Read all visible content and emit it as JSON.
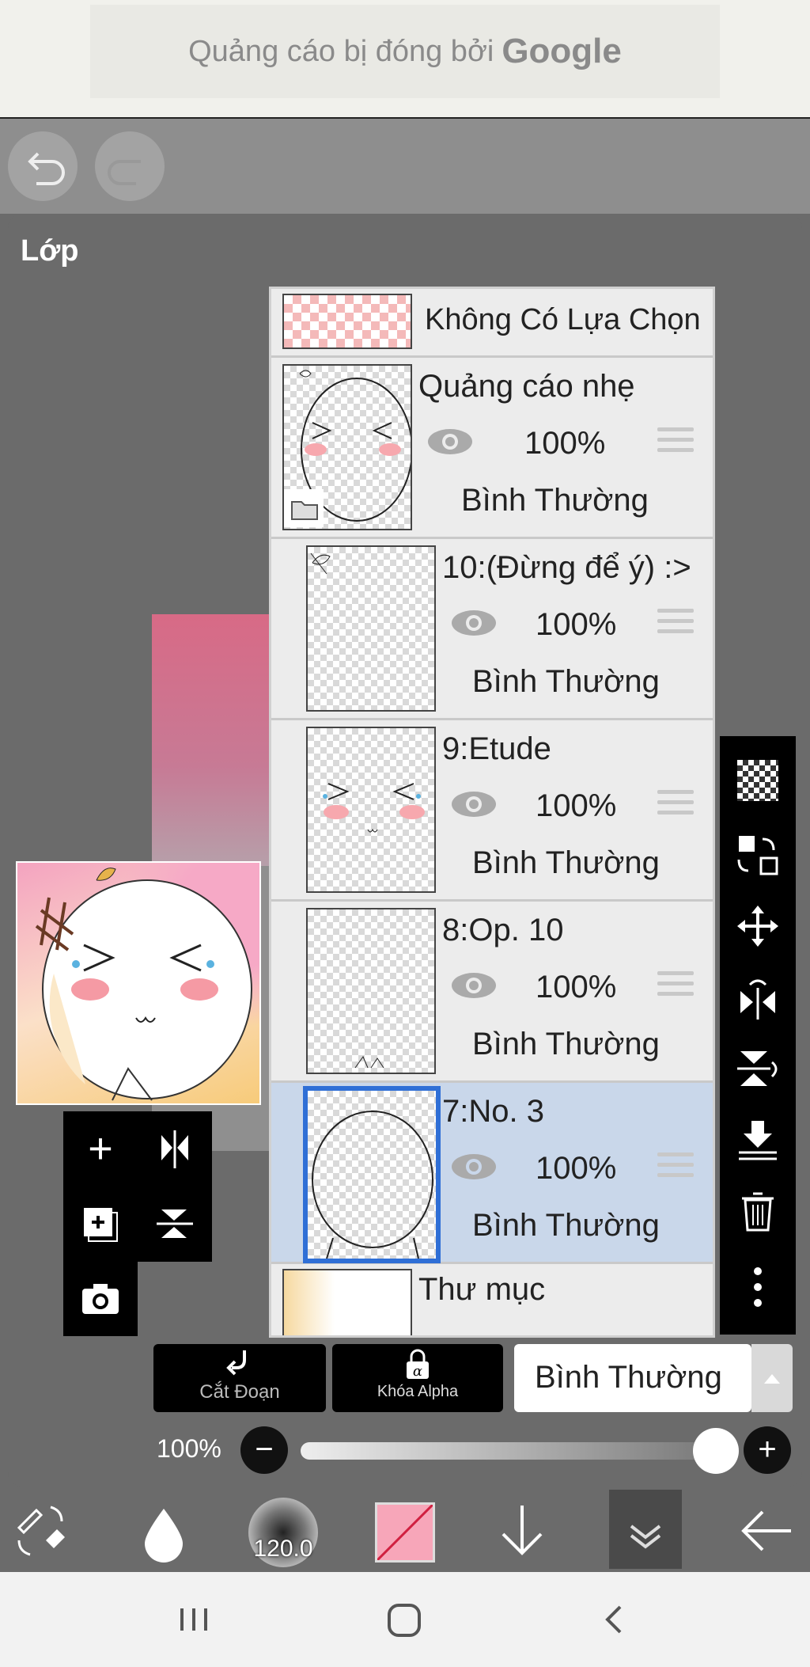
{
  "ad": {
    "text": "Quảng cáo bị đóng bởi",
    "brand": "Google"
  },
  "panel": {
    "title": "Lớp"
  },
  "layers": [
    {
      "name": "Không Có Lựa Chọn"
    },
    {
      "name": "Quảng cáo nhẹ",
      "opacity": "100%",
      "blend": "Bình Thường",
      "is_folder": true
    },
    {
      "name": "10:(Đừng để ý) :>",
      "opacity": "100%",
      "blend": "Bình Thường"
    },
    {
      "name": "9:Etude",
      "opacity": "100%",
      "blend": "Bình Thường"
    },
    {
      "name": "8:Op. 10",
      "opacity": "100%",
      "blend": "Bình Thường"
    },
    {
      "name": "7:No. 3",
      "opacity": "100%",
      "blend": "Bình Thường",
      "selected": true
    },
    {
      "name": "Thư mục"
    }
  ],
  "controls": {
    "clip_label": "Cắt Đoạn",
    "alpha_lock_label": "Khóa Alpha",
    "blend_mode": "Bình Thường",
    "opacity_label": "100%",
    "opacity_value": 1.0
  },
  "bottom_toolbar": {
    "brush_size": "120.0"
  },
  "colors": {
    "selected_row": "#c9d7ea",
    "current_color": "#f7a6b9",
    "accent": "#2f6fd6"
  }
}
